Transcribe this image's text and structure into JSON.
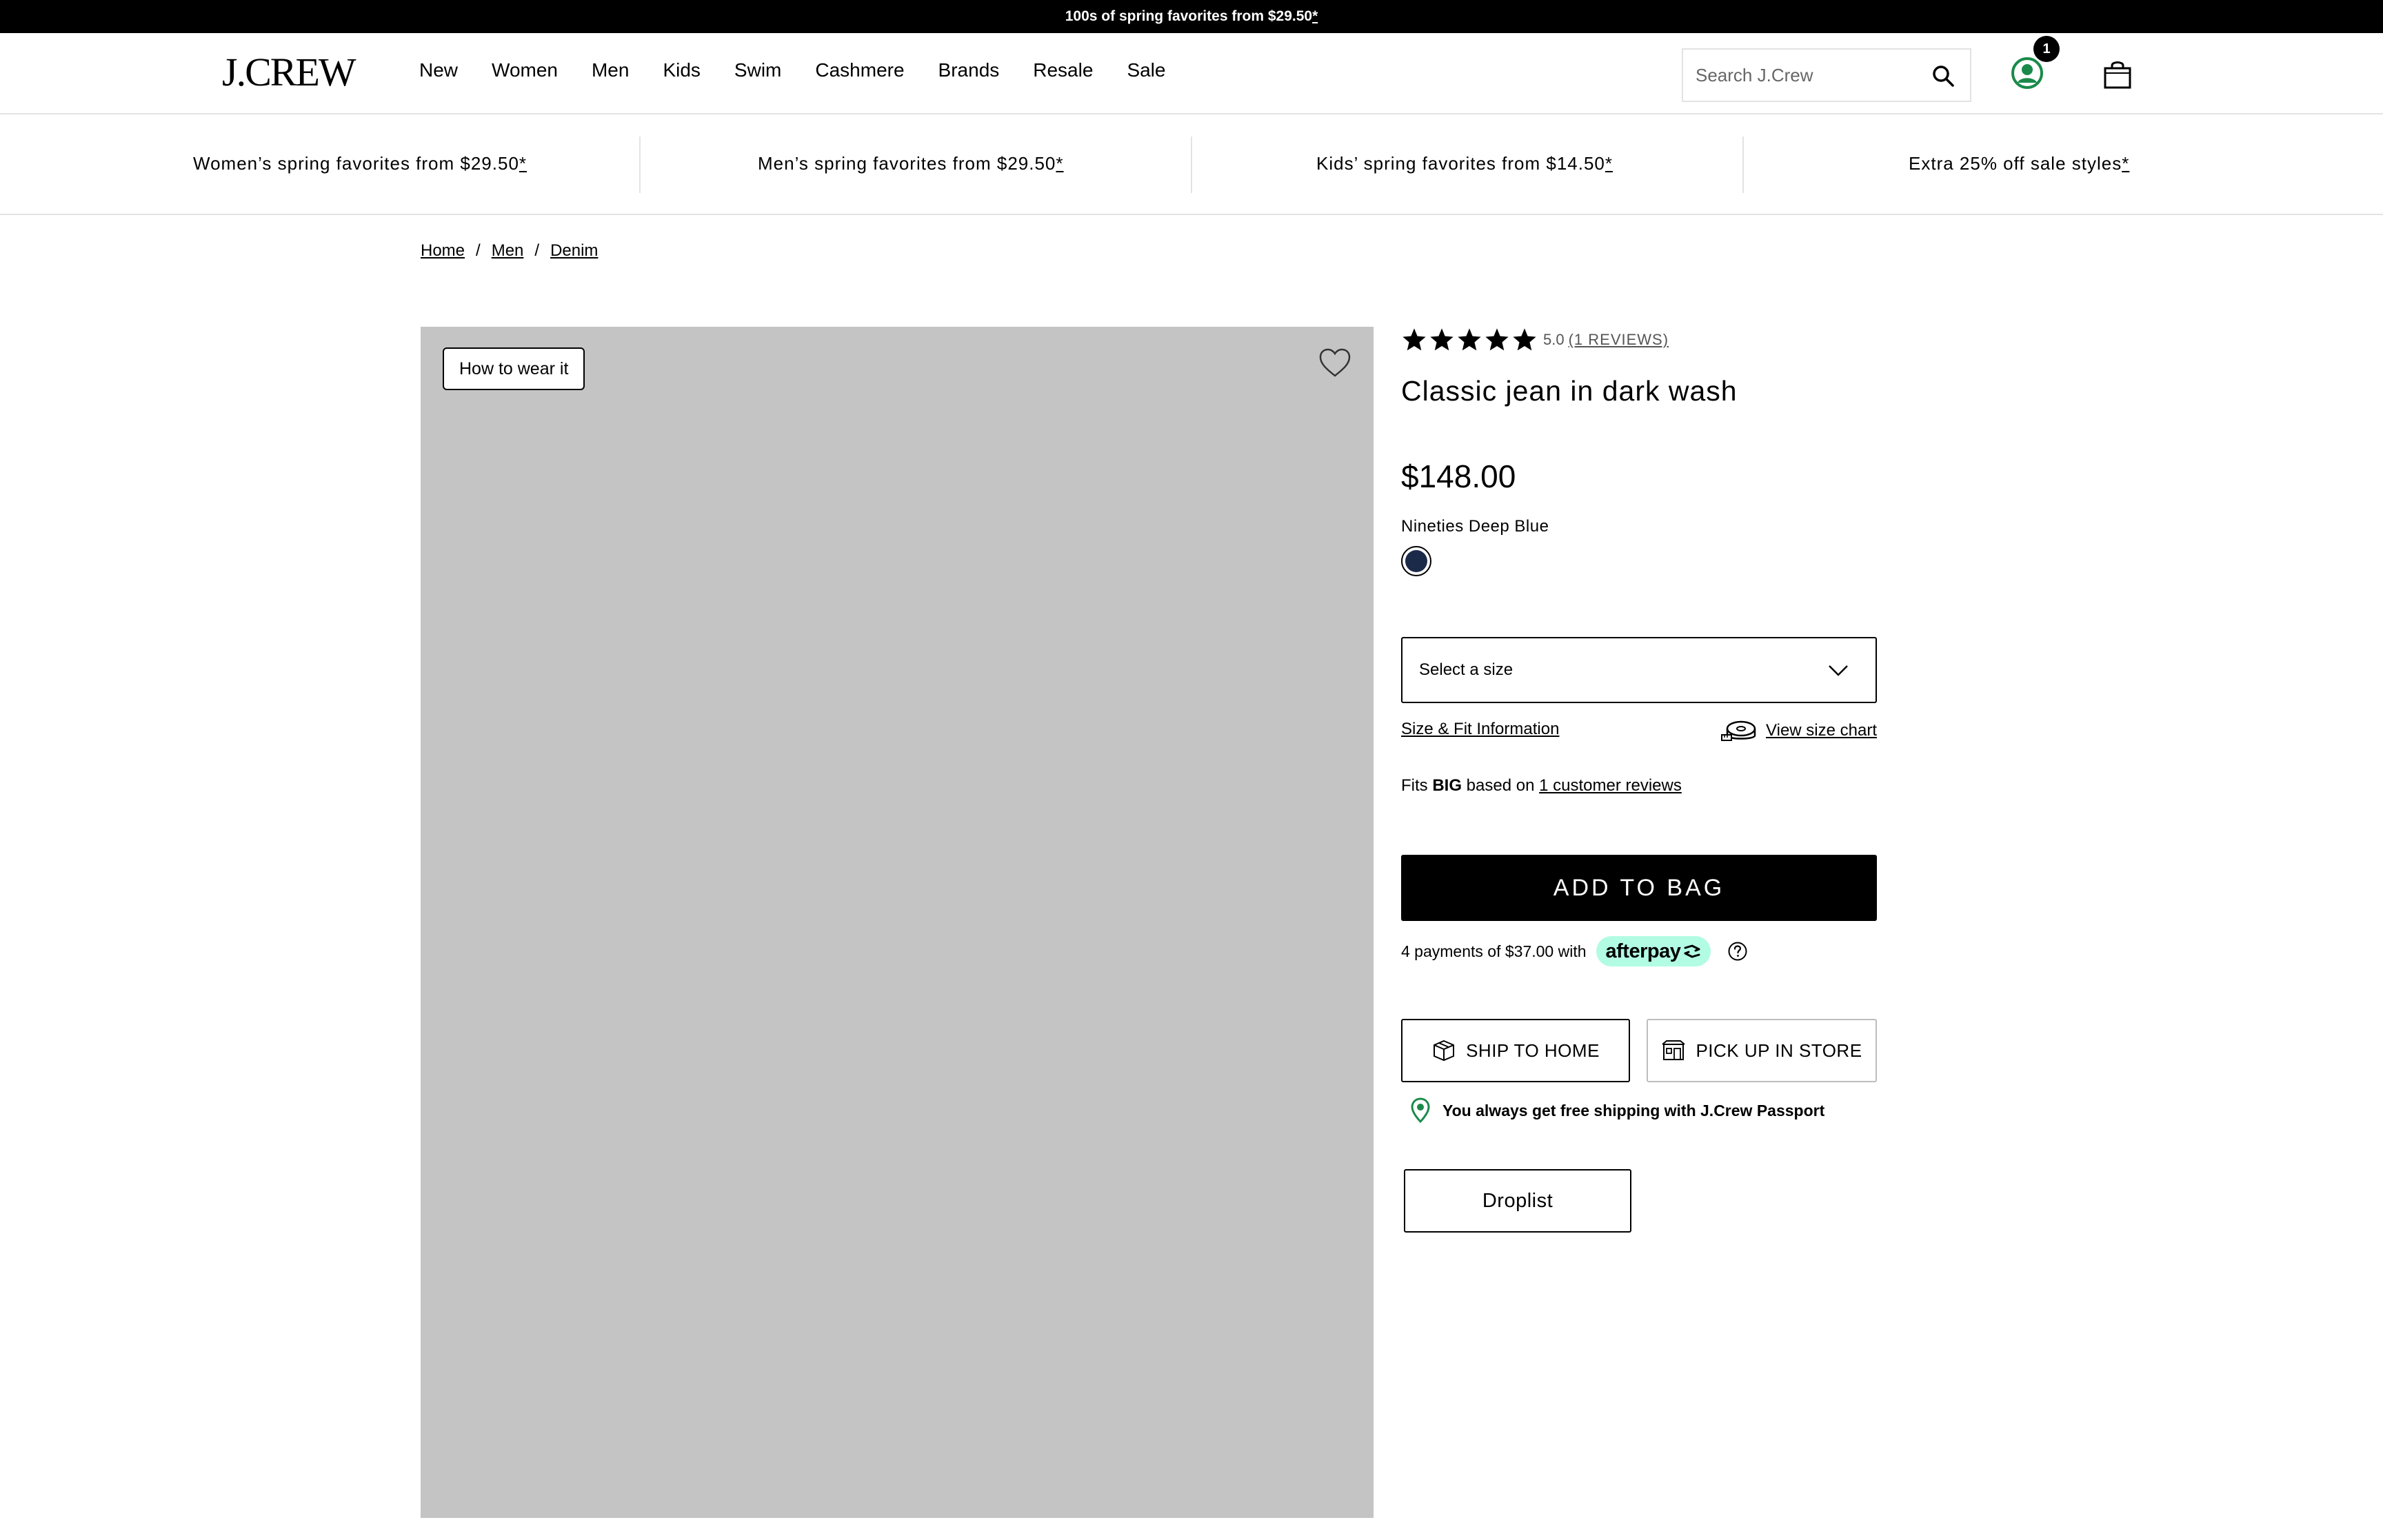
{
  "top_banner": {
    "text": "100s of spring favorites from $29.50",
    "asterisk": "*"
  },
  "header": {
    "logo": "J.CREW",
    "nav": [
      "New",
      "Women",
      "Men",
      "Kids",
      "Swim",
      "Cashmere",
      "Brands",
      "Resale",
      "Sale"
    ],
    "search_placeholder": "Search J.Crew",
    "cart_badge": "1"
  },
  "promos": [
    {
      "text": "Women’s spring favorites from $29.50",
      "asterisk": "*"
    },
    {
      "text": "Men’s spring favorites from $29.50",
      "asterisk": "*"
    },
    {
      "text": "Kids’ spring favorites from $14.50",
      "asterisk": "*"
    },
    {
      "text": "Extra 25% off sale styles",
      "asterisk": "*"
    }
  ],
  "breadcrumb": {
    "items": [
      "Home",
      "Men",
      "Denim"
    ],
    "separator": "/"
  },
  "gallery": {
    "wear_button": "How to wear it"
  },
  "product": {
    "rating_score": "5.0",
    "reviews_link": "(1 REVIEWS)",
    "title": "Classic jean in dark wash",
    "price": "$148.00",
    "color_name": "Nineties Deep Blue",
    "swatch_color": "#1c2a4a",
    "size_placeholder": "Select a size",
    "fit_info_link": "Size & Fit Information",
    "size_chart_link": "View size chart",
    "fits": {
      "prefix": "Fits ",
      "value": "BIG",
      "middle": " based on ",
      "link": "1 customer reviews"
    },
    "add_to_bag": "ADD TO BAG",
    "afterpay": {
      "text": "4 payments of $37.00 with",
      "brand": "afterpay",
      "brand_color": "#b2fce4"
    },
    "ship_to_home": "SHIP TO HOME",
    "pick_up_in_store": "PICK UP IN STORE",
    "passport_text": "You always get free shipping with J.Crew Passport",
    "passport_icon_color": "#1a8a4a",
    "droplist": "Droplist"
  },
  "colors": {
    "account_icon": "#1a8a4a"
  }
}
